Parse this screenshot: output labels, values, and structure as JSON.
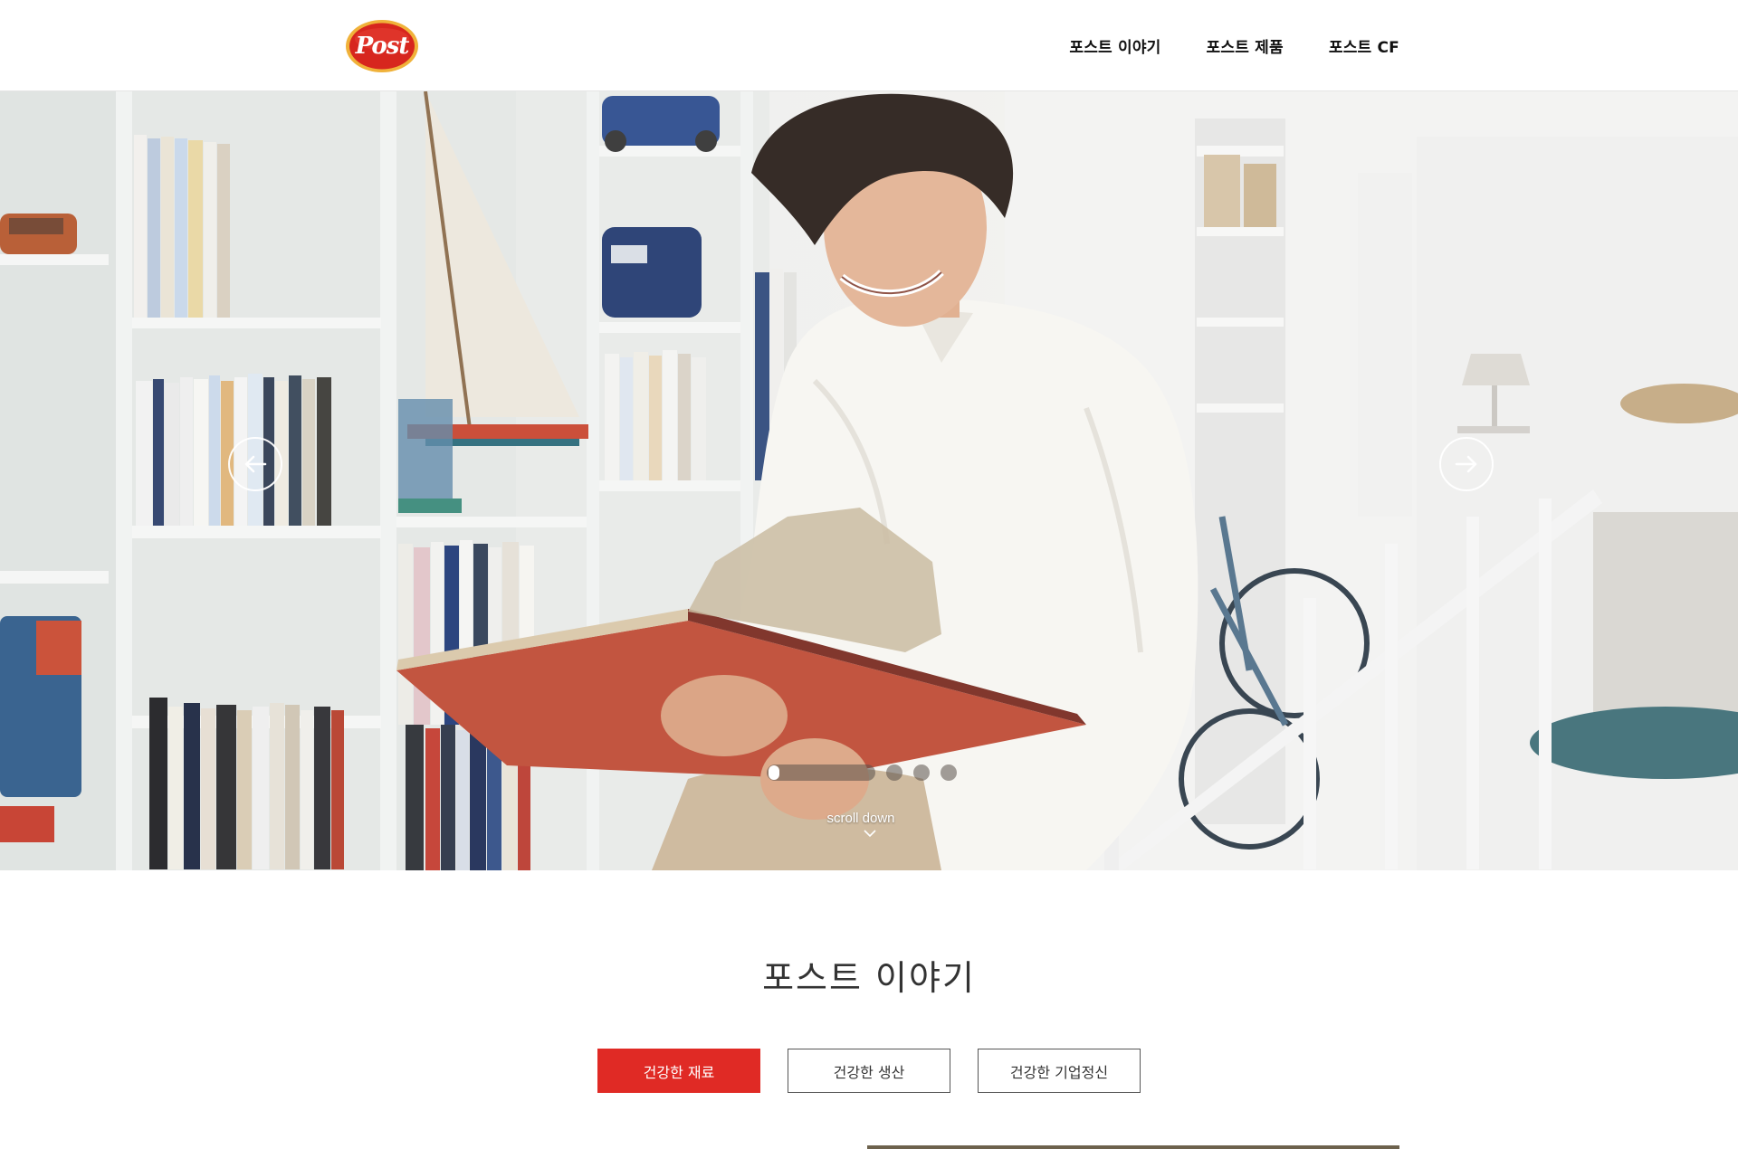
{
  "header": {
    "logo_text": "Post",
    "nav": [
      "포스트 이야기",
      "포스트 제품",
      "포스트 CF"
    ]
  },
  "hero": {
    "scroll_label": "scroll down",
    "slides_total": 4,
    "active_slide": 1
  },
  "story": {
    "title": "포스트 이야기",
    "tabs": [
      {
        "label": "건강한 재료",
        "active": true
      },
      {
        "label": "건강한 생산",
        "active": false
      },
      {
        "label": "건강한 기업정신",
        "active": false
      }
    ]
  },
  "colors": {
    "accent": "#e02a25",
    "logo_red": "#d7261e",
    "logo_gold": "#f0b23a"
  },
  "icons": {
    "prev": "arrow-left-icon",
    "next": "arrow-right-icon",
    "scroll": "chevron-down-icon"
  }
}
